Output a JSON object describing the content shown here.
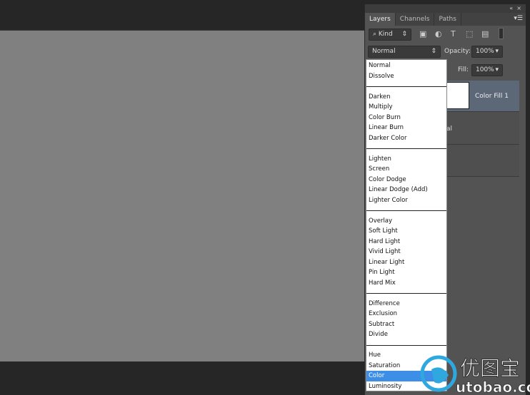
{
  "panel": {
    "tabs": [
      "Layers",
      "Channels",
      "Paths"
    ],
    "collapse_icon": "«",
    "close_icon": "×",
    "filter": {
      "label": "Kind",
      "icons": [
        "image-icon",
        "adjustment-icon",
        "type-icon",
        "shape-icon",
        "smart-object-icon",
        "filter-toggle-icon"
      ]
    },
    "blend_mode": "Normal",
    "opacity_label": "Opacity:",
    "opacity": "100%",
    "fill_label": "Fill:",
    "fill": "100%",
    "layers": [
      {
        "name": "Color Fill 1",
        "selected": true
      },
      {
        "name": "al"
      },
      {
        "name": ""
      }
    ]
  },
  "blend_menu": {
    "groups": [
      [
        "Normal",
        "Dissolve"
      ],
      [
        "Darken",
        "Multiply",
        "Color Burn",
        "Linear Burn",
        "Darker Color"
      ],
      [
        "Lighten",
        "Screen",
        "Color Dodge",
        "Linear Dodge (Add)",
        "Lighter Color"
      ],
      [
        "Overlay",
        "Soft Light",
        "Hard Light",
        "Vivid Light",
        "Linear Light",
        "Pin Light",
        "Hard Mix"
      ],
      [
        "Difference",
        "Exclusion",
        "Subtract",
        "Divide"
      ],
      [
        "Hue",
        "Saturation",
        "Color",
        "Luminosity"
      ]
    ],
    "highlighted": "Color",
    "highlight_color": "#3c8ee6"
  },
  "watermark": {
    "cn": "优图宝",
    "url": "utobao.com"
  }
}
